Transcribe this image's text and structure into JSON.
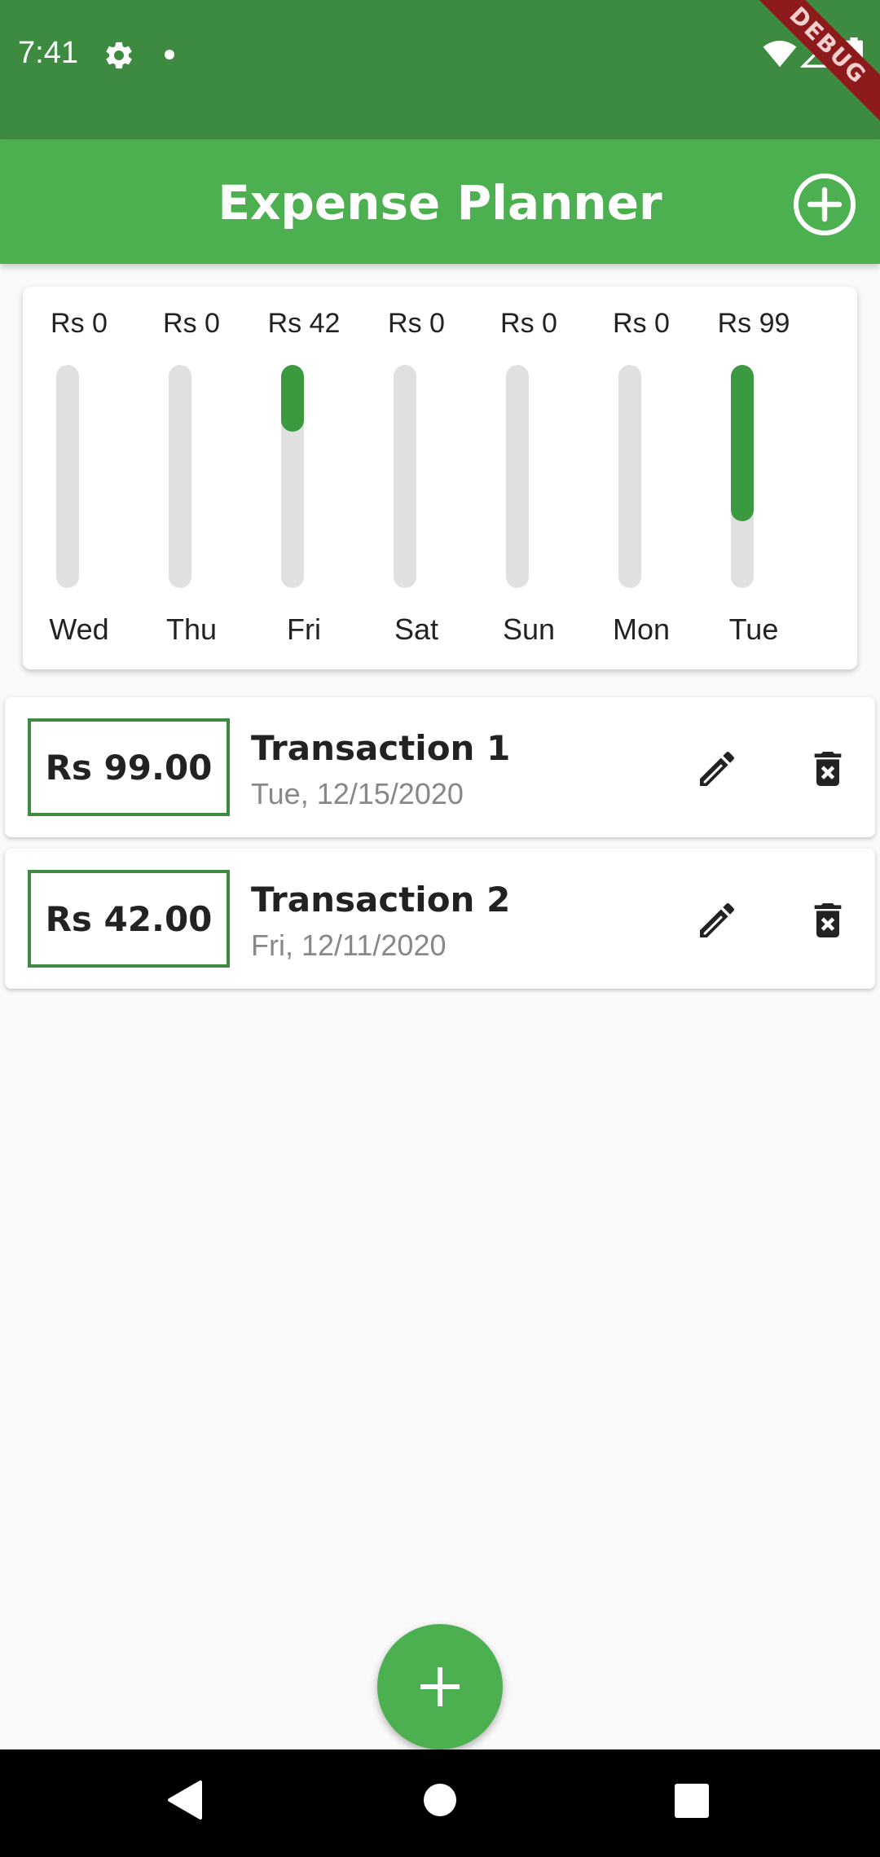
{
  "status_bar": {
    "time": "7:41",
    "icons": [
      "gear-icon",
      "notification-dot",
      "wifi-icon",
      "signal-icon",
      "battery-icon"
    ],
    "debug_label": "DEBUG"
  },
  "app_bar": {
    "title": "Expense Planner",
    "add_icon": "add-circle-icon"
  },
  "chart": {
    "max_value": 99,
    "bars": [
      {
        "day": "Wed",
        "amount_label": "Rs 0",
        "value": 0
      },
      {
        "day": "Thu",
        "amount_label": "Rs 0",
        "value": 0
      },
      {
        "day": "Fri",
        "amount_label": "Rs 42",
        "value": 42
      },
      {
        "day": "Sat",
        "amount_label": "Rs 0",
        "value": 0
      },
      {
        "day": "Sun",
        "amount_label": "Rs 0",
        "value": 0
      },
      {
        "day": "Mon",
        "amount_label": "Rs 0",
        "value": 0
      },
      {
        "day": "Tue",
        "amount_label": "Rs 99",
        "value": 99
      }
    ],
    "fill_fractions": [
      0,
      0,
      0.3,
      0,
      0,
      0,
      0.7
    ]
  },
  "transactions": [
    {
      "amount": "Rs 99.00",
      "title": "Transaction 1",
      "date": "Tue, 12/15/2020"
    },
    {
      "amount": "Rs 42.00",
      "title": "Transaction 2",
      "date": "Fri, 12/11/2020"
    }
  ],
  "colors": {
    "status_bar": "#3D8B40",
    "app_bar": "#4CAF50",
    "bar_fill": "#3B9A3F",
    "bar_track": "#E0E0E0",
    "amount_border": "#3D8B40"
  }
}
